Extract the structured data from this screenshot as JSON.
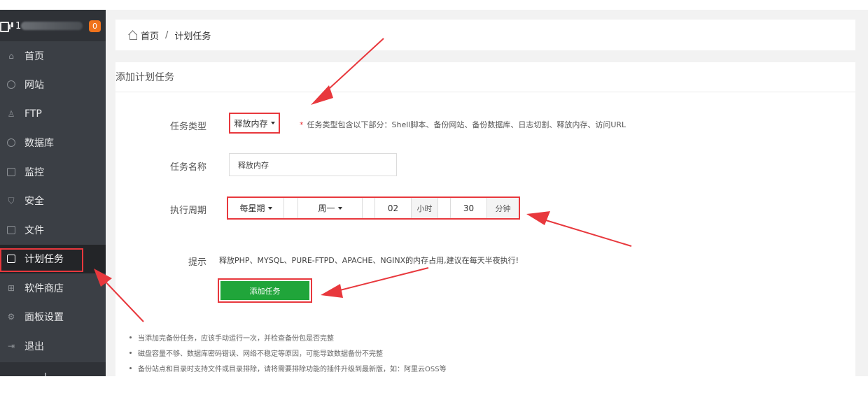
{
  "sidebar": {
    "badge_count": "0",
    "ip_prefix": "1",
    "items": [
      {
        "label": "首页",
        "icon": "home-icon"
      },
      {
        "label": "网站",
        "icon": "globe-icon"
      },
      {
        "label": "FTP",
        "icon": "user-icon"
      },
      {
        "label": "数据库",
        "icon": "database-icon"
      },
      {
        "label": "监控",
        "icon": "monitor-icon"
      },
      {
        "label": "安全",
        "icon": "shield-icon"
      },
      {
        "label": "文件",
        "icon": "folder-icon"
      },
      {
        "label": "计划任务",
        "icon": "calendar-icon",
        "active": true
      },
      {
        "label": "软件商店",
        "icon": "grid-icon"
      },
      {
        "label": "面板设置",
        "icon": "gear-icon"
      },
      {
        "label": "退出",
        "icon": "logout-icon"
      }
    ]
  },
  "breadcrumb": {
    "home": "首页",
    "separator": "/",
    "current": "计划任务"
  },
  "panel": {
    "title": "添加计划任务"
  },
  "form": {
    "type": {
      "label": "任务类型",
      "value": "释放内存",
      "note_star": "*",
      "note": "任务类型包含以下部分：Shell脚本、备份网站、备份数据库、日志切割、释放内存、访问URL"
    },
    "name": {
      "label": "任务名称",
      "value": "释放内存"
    },
    "period": {
      "label": "执行周期",
      "cycle": "每星期",
      "weekday": "周一",
      "hour": "02",
      "hour_unit": "小时",
      "minute": "30",
      "minute_unit": "分钟"
    },
    "tip": {
      "label": "提示",
      "text": "释放PHP、MYSQL、PURE-FTPD、APACHE、NGINX的内存占用,建议在每天半夜执行!"
    },
    "submit_label": "添加任务"
  },
  "notes": [
    "当添加完备份任务，应该手动运行一次，并检查备份包是否完整",
    "磁盘容量不够、数据库密码错误、网络不稳定等原因，可能导致数据备份不完整",
    "备份站点和目录时支持文件或目录排除，请将需要排除功能的插件升级到最新版，如：阿里云OSS等"
  ],
  "colors": {
    "sidebar_bg": "#3b3f45",
    "sidebar_active": "#232528",
    "accent_green": "#20a53a",
    "highlight_red": "#e8383d",
    "badge_orange": "#f0731c"
  }
}
